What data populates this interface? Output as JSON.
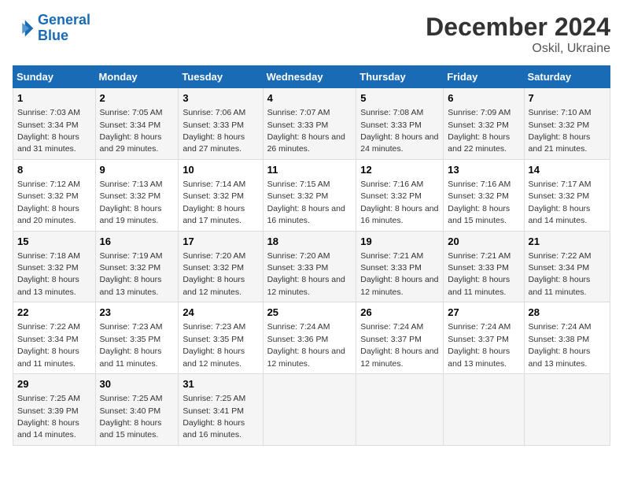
{
  "header": {
    "logo_line1": "General",
    "logo_line2": "Blue",
    "title": "December 2024",
    "subtitle": "Oskil, Ukraine"
  },
  "columns": [
    "Sunday",
    "Monday",
    "Tuesday",
    "Wednesday",
    "Thursday",
    "Friday",
    "Saturday"
  ],
  "weeks": [
    [
      {
        "day": "1",
        "rise": "Sunrise: 7:03 AM",
        "set": "Sunset: 3:34 PM",
        "daylight": "Daylight: 8 hours and 31 minutes."
      },
      {
        "day": "2",
        "rise": "Sunrise: 7:05 AM",
        "set": "Sunset: 3:34 PM",
        "daylight": "Daylight: 8 hours and 29 minutes."
      },
      {
        "day": "3",
        "rise": "Sunrise: 7:06 AM",
        "set": "Sunset: 3:33 PM",
        "daylight": "Daylight: 8 hours and 27 minutes."
      },
      {
        "day": "4",
        "rise": "Sunrise: 7:07 AM",
        "set": "Sunset: 3:33 PM",
        "daylight": "Daylight: 8 hours and 26 minutes."
      },
      {
        "day": "5",
        "rise": "Sunrise: 7:08 AM",
        "set": "Sunset: 3:33 PM",
        "daylight": "Daylight: 8 hours and 24 minutes."
      },
      {
        "day": "6",
        "rise": "Sunrise: 7:09 AM",
        "set": "Sunset: 3:32 PM",
        "daylight": "Daylight: 8 hours and 22 minutes."
      },
      {
        "day": "7",
        "rise": "Sunrise: 7:10 AM",
        "set": "Sunset: 3:32 PM",
        "daylight": "Daylight: 8 hours and 21 minutes."
      }
    ],
    [
      {
        "day": "8",
        "rise": "Sunrise: 7:12 AM",
        "set": "Sunset: 3:32 PM",
        "daylight": "Daylight: 8 hours and 20 minutes."
      },
      {
        "day": "9",
        "rise": "Sunrise: 7:13 AM",
        "set": "Sunset: 3:32 PM",
        "daylight": "Daylight: 8 hours and 19 minutes."
      },
      {
        "day": "10",
        "rise": "Sunrise: 7:14 AM",
        "set": "Sunset: 3:32 PM",
        "daylight": "Daylight: 8 hours and 17 minutes."
      },
      {
        "day": "11",
        "rise": "Sunrise: 7:15 AM",
        "set": "Sunset: 3:32 PM",
        "daylight": "Daylight: 8 hours and 16 minutes."
      },
      {
        "day": "12",
        "rise": "Sunrise: 7:16 AM",
        "set": "Sunset: 3:32 PM",
        "daylight": "Daylight: 8 hours and 16 minutes."
      },
      {
        "day": "13",
        "rise": "Sunrise: 7:16 AM",
        "set": "Sunset: 3:32 PM",
        "daylight": "Daylight: 8 hours and 15 minutes."
      },
      {
        "day": "14",
        "rise": "Sunrise: 7:17 AM",
        "set": "Sunset: 3:32 PM",
        "daylight": "Daylight: 8 hours and 14 minutes."
      }
    ],
    [
      {
        "day": "15",
        "rise": "Sunrise: 7:18 AM",
        "set": "Sunset: 3:32 PM",
        "daylight": "Daylight: 8 hours and 13 minutes."
      },
      {
        "day": "16",
        "rise": "Sunrise: 7:19 AM",
        "set": "Sunset: 3:32 PM",
        "daylight": "Daylight: 8 hours and 13 minutes."
      },
      {
        "day": "17",
        "rise": "Sunrise: 7:20 AM",
        "set": "Sunset: 3:32 PM",
        "daylight": "Daylight: 8 hours and 12 minutes."
      },
      {
        "day": "18",
        "rise": "Sunrise: 7:20 AM",
        "set": "Sunset: 3:33 PM",
        "daylight": "Daylight: 8 hours and 12 minutes."
      },
      {
        "day": "19",
        "rise": "Sunrise: 7:21 AM",
        "set": "Sunset: 3:33 PM",
        "daylight": "Daylight: 8 hours and 12 minutes."
      },
      {
        "day": "20",
        "rise": "Sunrise: 7:21 AM",
        "set": "Sunset: 3:33 PM",
        "daylight": "Daylight: 8 hours and 11 minutes."
      },
      {
        "day": "21",
        "rise": "Sunrise: 7:22 AM",
        "set": "Sunset: 3:34 PM",
        "daylight": "Daylight: 8 hours and 11 minutes."
      }
    ],
    [
      {
        "day": "22",
        "rise": "Sunrise: 7:22 AM",
        "set": "Sunset: 3:34 PM",
        "daylight": "Daylight: 8 hours and 11 minutes."
      },
      {
        "day": "23",
        "rise": "Sunrise: 7:23 AM",
        "set": "Sunset: 3:35 PM",
        "daylight": "Daylight: 8 hours and 11 minutes."
      },
      {
        "day": "24",
        "rise": "Sunrise: 7:23 AM",
        "set": "Sunset: 3:35 PM",
        "daylight": "Daylight: 8 hours and 12 minutes."
      },
      {
        "day": "25",
        "rise": "Sunrise: 7:24 AM",
        "set": "Sunset: 3:36 PM",
        "daylight": "Daylight: 8 hours and 12 minutes."
      },
      {
        "day": "26",
        "rise": "Sunrise: 7:24 AM",
        "set": "Sunset: 3:37 PM",
        "daylight": "Daylight: 8 hours and 12 minutes."
      },
      {
        "day": "27",
        "rise": "Sunrise: 7:24 AM",
        "set": "Sunset: 3:37 PM",
        "daylight": "Daylight: 8 hours and 13 minutes."
      },
      {
        "day": "28",
        "rise": "Sunrise: 7:24 AM",
        "set": "Sunset: 3:38 PM",
        "daylight": "Daylight: 8 hours and 13 minutes."
      }
    ],
    [
      {
        "day": "29",
        "rise": "Sunrise: 7:25 AM",
        "set": "Sunset: 3:39 PM",
        "daylight": "Daylight: 8 hours and 14 minutes."
      },
      {
        "day": "30",
        "rise": "Sunrise: 7:25 AM",
        "set": "Sunset: 3:40 PM",
        "daylight": "Daylight: 8 hours and 15 minutes."
      },
      {
        "day": "31",
        "rise": "Sunrise: 7:25 AM",
        "set": "Sunset: 3:41 PM",
        "daylight": "Daylight: 8 hours and 16 minutes."
      },
      null,
      null,
      null,
      null
    ]
  ]
}
